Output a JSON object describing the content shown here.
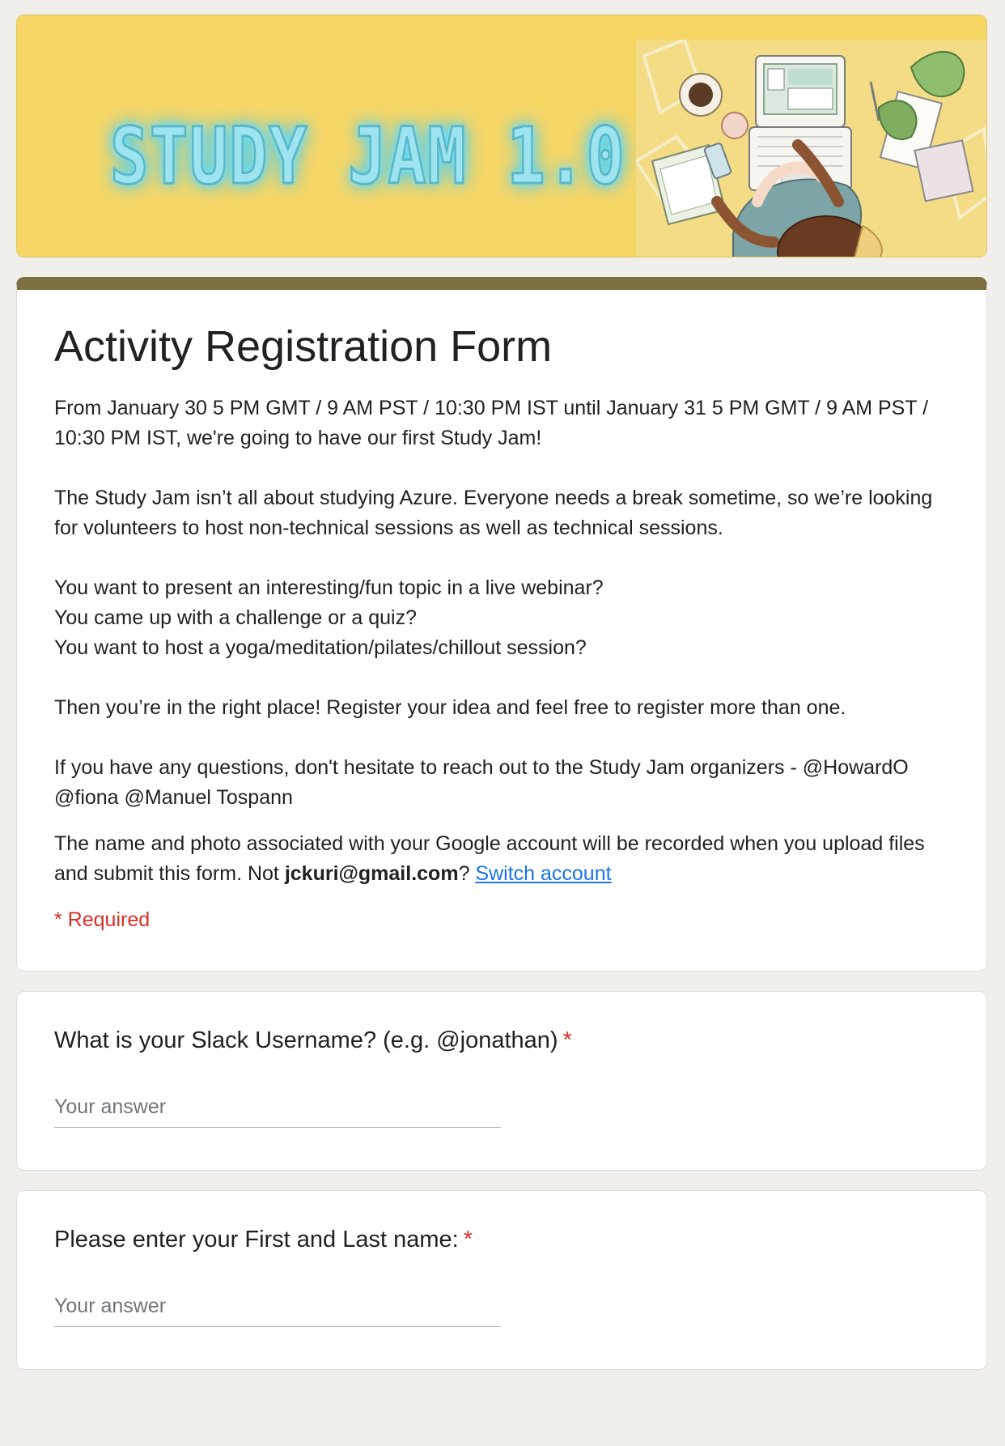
{
  "banner": {
    "title": "STUDY JAM 1.0"
  },
  "form": {
    "title": "Activity Registration Form",
    "description": [
      "From January 30 5 PM GMT / 9 AM PST / 10:30 PM IST until January 31 5 PM GMT / 9 AM PST / 10:30 PM IST, we're going to have our first Study Jam!",
      "The Study Jam isn’t all about studying Azure. Everyone needs a break sometime, so we’re looking for volunteers to host non-technical sessions as well as technical sessions.",
      "You want to present an interesting/fun topic in a live webinar?",
      "You came up with a challenge or a quiz?",
      "You want to host a yoga/meditation/pilates/chillout session?",
      "Then you’re in the right place! Register your idea and feel free to register more than one.",
      "If you have any questions, don't hesitate to reach out to the Study Jam organizers - @HowardO @fiona @Manuel Tospann"
    ],
    "account_notice_prefix": "The name and photo associated with your Google account will be recorded when you upload files and submit this form. Not ",
    "account_email": "jckuri@gmail.com",
    "account_notice_suffix": "? ",
    "switch_account_label": "Switch account",
    "required_note": "* Required"
  },
  "questions": [
    {
      "label": "What is your Slack Username? (e.g. @jonathan)",
      "required_mark": "*",
      "placeholder": "Your answer",
      "value": ""
    },
    {
      "label": "Please enter your First and Last name:",
      "required_mark": "*",
      "placeholder": "Your answer",
      "value": ""
    }
  ],
  "colors": {
    "page_background": "#f0efec",
    "banner_background": "#f8d666",
    "header_accent": "#7b6e3f",
    "required": "#d93025",
    "link": "#1a73e8"
  }
}
